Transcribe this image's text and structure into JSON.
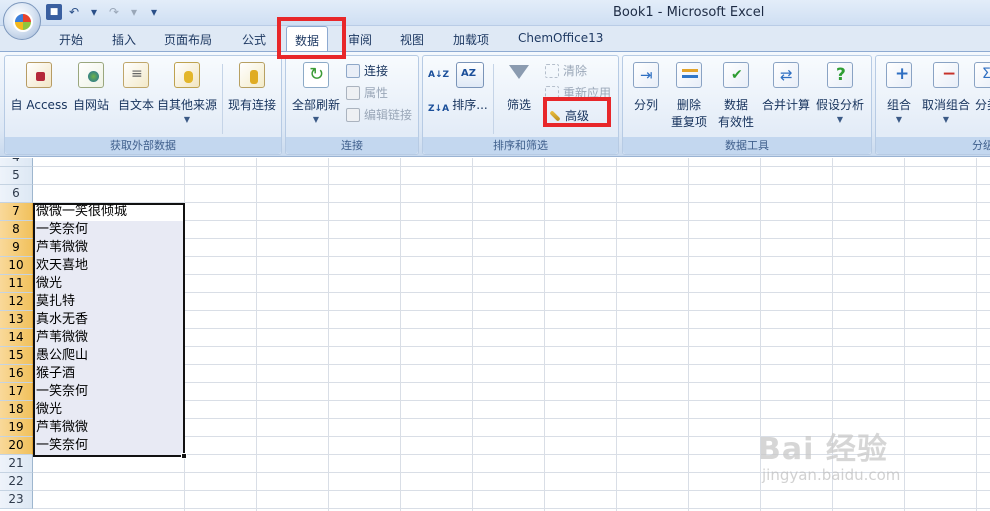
{
  "window_title": "Book1 - Microsoft Excel",
  "tabs": [
    {
      "label": "开始"
    },
    {
      "label": "插入"
    },
    {
      "label": "页面布局"
    },
    {
      "label": "公式"
    },
    {
      "label": "数据"
    },
    {
      "label": "审阅"
    },
    {
      "label": "视图"
    },
    {
      "label": "加载项"
    },
    {
      "label": "ChemOffice13"
    }
  ],
  "ribbon": {
    "external": {
      "label": "获取外部数据",
      "access": "自 Access",
      "web": "自网站",
      "text": "自文本",
      "other": "自其他来源",
      "existing": "现有连接"
    },
    "connections": {
      "label": "连接",
      "refresh": "全部刷新",
      "connections": "连接",
      "properties": "属性",
      "edit_links": "编辑链接"
    },
    "sort_filter": {
      "label": "排序和筛选",
      "sort": "排序...",
      "filter": "筛选",
      "clear": "清除",
      "reapply": "重新应用",
      "advanced": "高级"
    },
    "data_tools": {
      "label": "数据工具",
      "split": "分列",
      "remove_dup_1": "删除",
      "remove_dup_2": "重复项",
      "validation_1": "数据",
      "validation_2": "有效性",
      "consolidate": "合并计算",
      "whatif": "假设分析"
    },
    "outline": {
      "label": "分级",
      "group": "组合",
      "ungroup": "取消组合",
      "subtotal": "分类"
    }
  },
  "rows": [
    {
      "num": "4",
      "value": ""
    },
    {
      "num": "5",
      "value": ""
    },
    {
      "num": "6",
      "value": ""
    },
    {
      "num": "7",
      "value": "微微一笑很倾城"
    },
    {
      "num": "8",
      "value": "一笑奈何"
    },
    {
      "num": "9",
      "value": "芦苇微微"
    },
    {
      "num": "10",
      "value": "欢天喜地"
    },
    {
      "num": "11",
      "value": "微光"
    },
    {
      "num": "12",
      "value": "莫扎特"
    },
    {
      "num": "13",
      "value": "真水无香"
    },
    {
      "num": "14",
      "value": "芦苇微微"
    },
    {
      "num": "15",
      "value": "愚公爬山"
    },
    {
      "num": "16",
      "value": "猴子酒"
    },
    {
      "num": "17",
      "value": "一笑奈何"
    },
    {
      "num": "18",
      "value": "微光"
    },
    {
      "num": "19",
      "value": "芦苇微微"
    },
    {
      "num": "20",
      "value": "一笑奈何"
    },
    {
      "num": "21",
      "value": ""
    },
    {
      "num": "22",
      "value": ""
    },
    {
      "num": "23",
      "value": ""
    }
  ],
  "watermark": {
    "brand": "Bai 经验",
    "url": "jingyan.baidu.com"
  },
  "accent_colors": {
    "highlight_box": "#e8272a",
    "selected_row_header": "#f1c15c"
  }
}
